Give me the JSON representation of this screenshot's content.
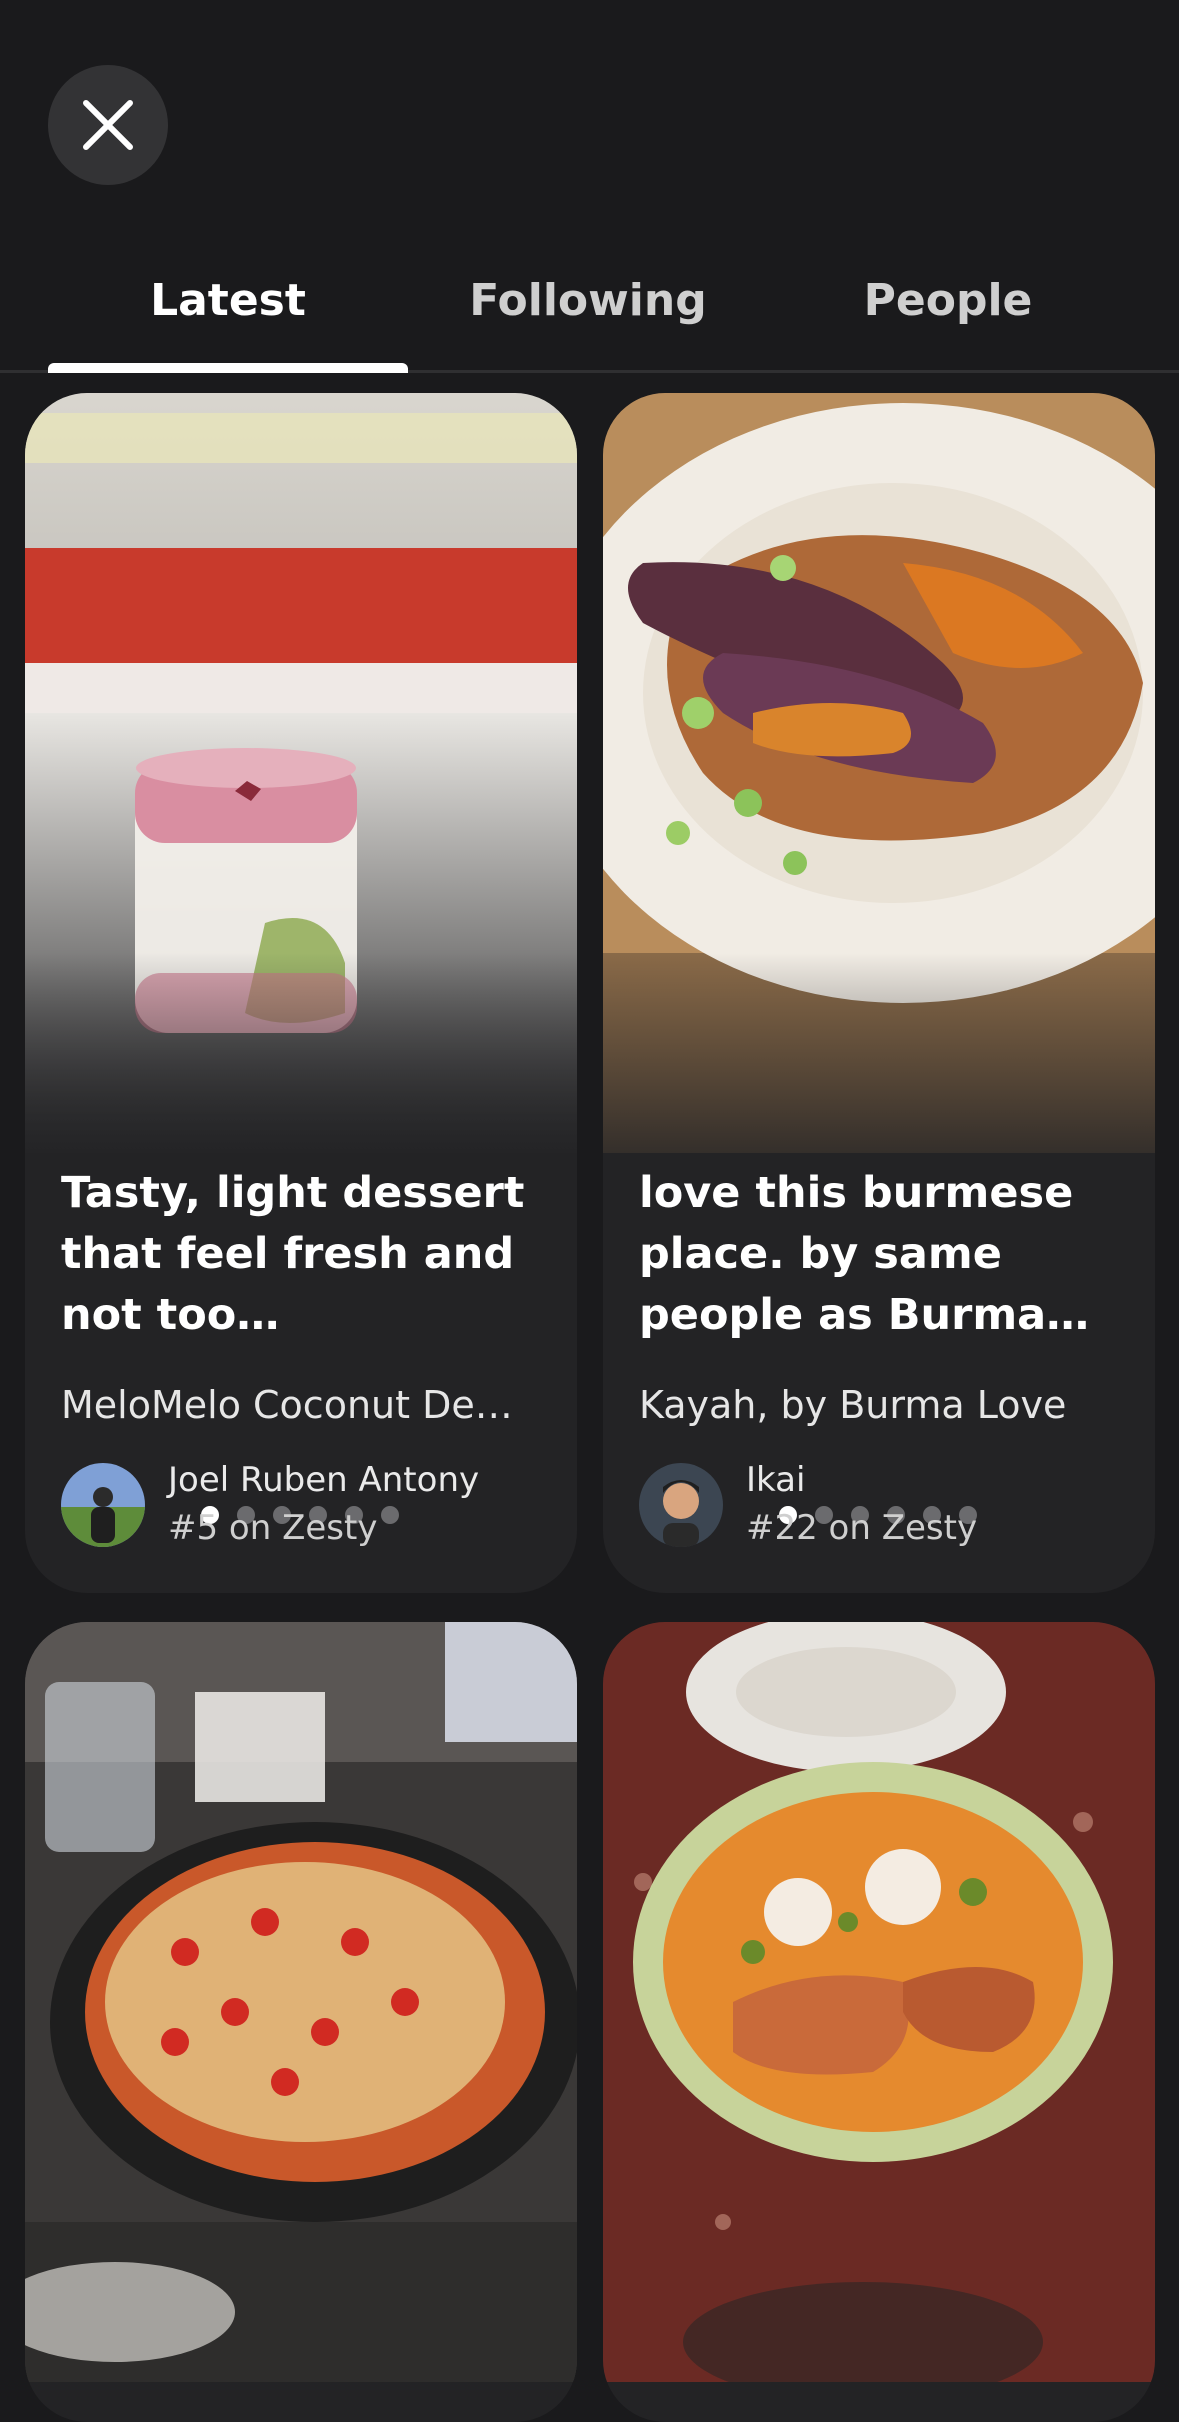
{
  "tabs": [
    {
      "label": "Latest",
      "active": true
    },
    {
      "label": "Following",
      "active": false
    },
    {
      "label": "People",
      "active": false
    }
  ],
  "cards": [
    {
      "title": "Tasty, light dessert that feel fresh and not too…",
      "place": "MeloMelo Coconut De…",
      "author": "Joel Ruben Antony",
      "rank": "#5 on Zesty",
      "photo_count": 6,
      "active_photo": 1
    },
    {
      "title": "love this burmese place. by same people as Burma…",
      "place": "Kayah, by Burma Love",
      "author": "Ikai",
      "rank": "#22 on Zesty",
      "photo_count": 6,
      "active_photo": 1
    },
    {
      "title": "",
      "place": "",
      "author": "",
      "rank": ""
    },
    {
      "title": "",
      "place": "",
      "author": "",
      "rank": ""
    }
  ],
  "colors": {
    "background": "#1a1a1c",
    "card": "#232325",
    "tab_indicator": "#ffffff"
  },
  "icons": {
    "close": "close-icon"
  }
}
